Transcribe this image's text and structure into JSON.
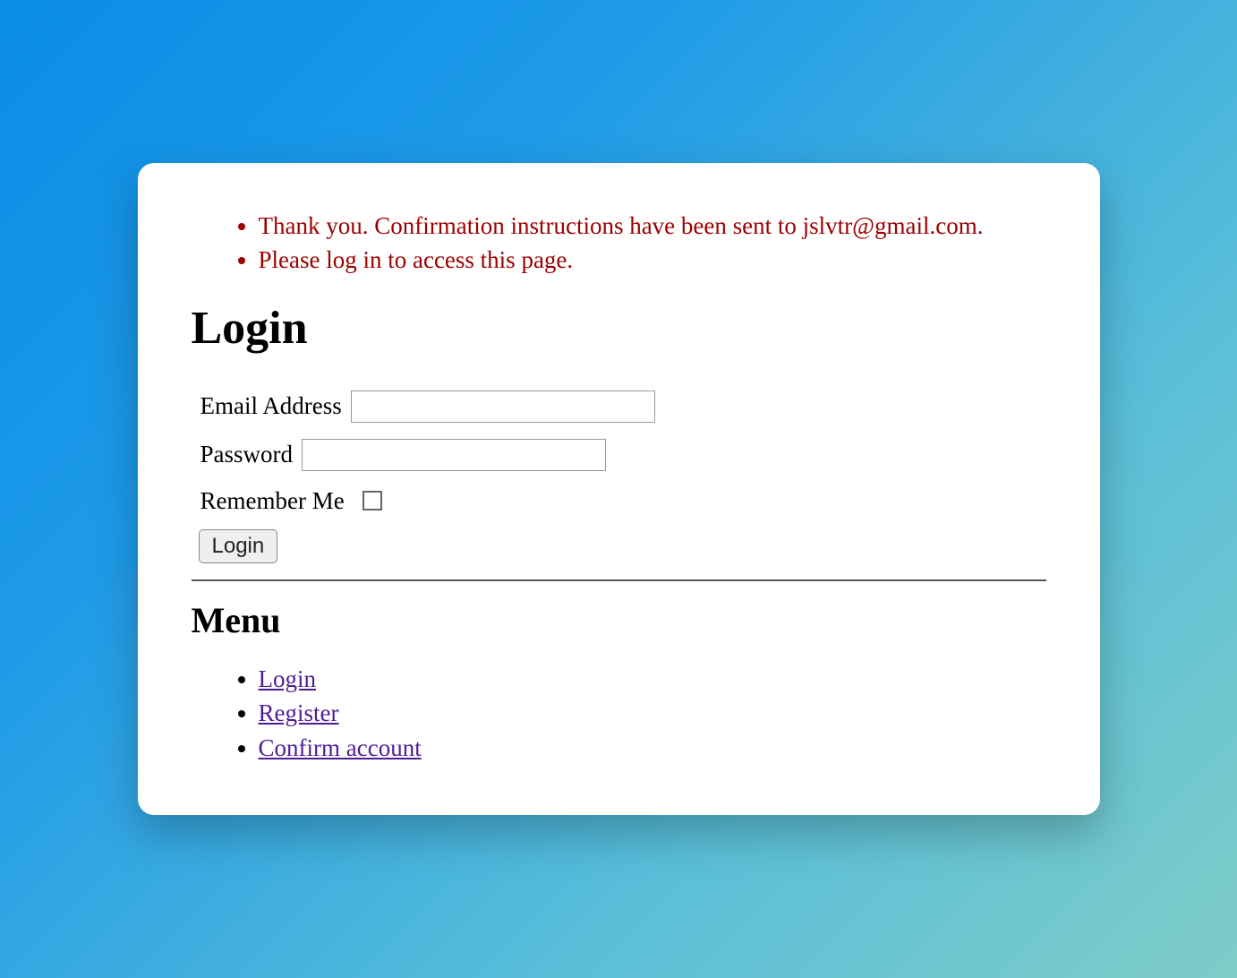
{
  "flash_messages": [
    "Thank you. Confirmation instructions have been sent to jslvtr@gmail.com.",
    "Please log in to access this page."
  ],
  "login": {
    "title": "Login",
    "email_label": "Email Address",
    "email_value": "",
    "password_label": "Password",
    "password_value": "",
    "remember_label": "Remember Me",
    "submit_label": "Login"
  },
  "menu": {
    "title": "Menu",
    "items": [
      {
        "label": "Login"
      },
      {
        "label": "Register"
      },
      {
        "label": "Confirm account"
      }
    ]
  }
}
